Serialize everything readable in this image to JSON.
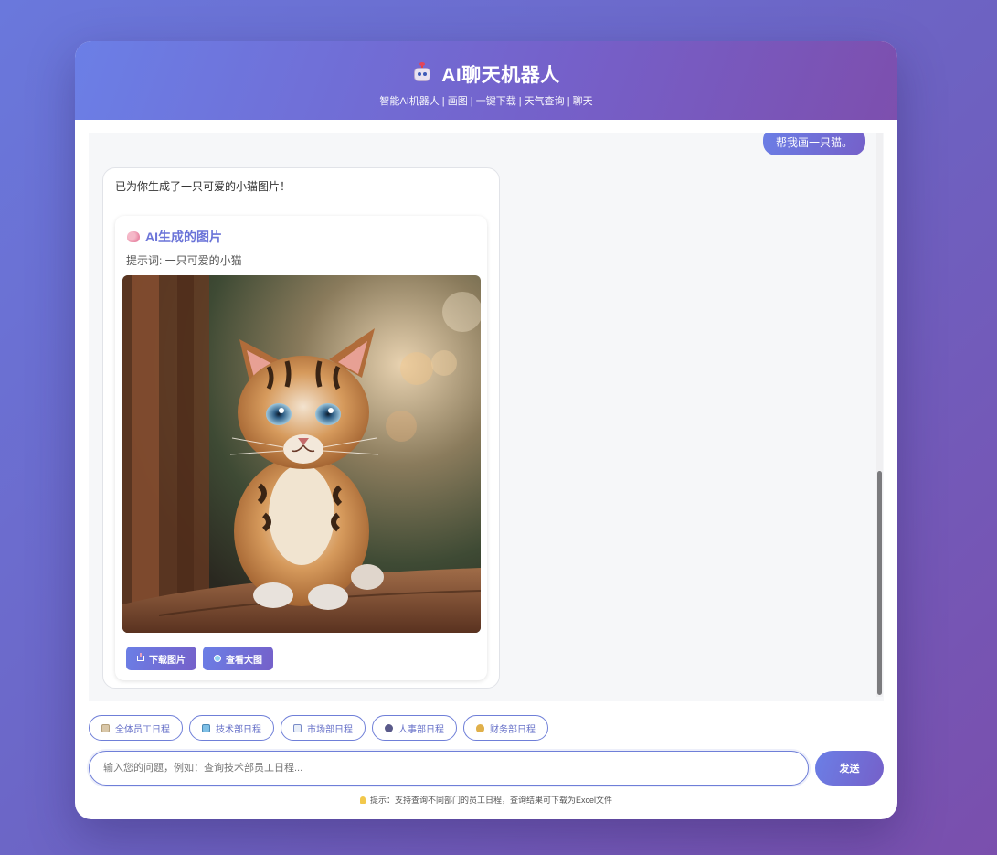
{
  "header": {
    "title": "AI聊天机器人",
    "subtitle": "智能AI机器人 | 画图 | 一键下载 | 天气查询 | 聊天"
  },
  "chat": {
    "user_message": "帮我画一只猫。",
    "bot_message": "已为你生成了一只可爱的小猫图片！",
    "image_card": {
      "title": "AI生成的图片",
      "prompt": "提示词: 一只可爱的小猫",
      "download_label": "下载图片",
      "view_label": "查看大图"
    }
  },
  "quick_actions": [
    {
      "label": "全体员工日程",
      "icon": "clipboard-icon"
    },
    {
      "label": "技术部日程",
      "icon": "computer-icon"
    },
    {
      "label": "市场部日程",
      "icon": "chart-icon"
    },
    {
      "label": "人事部日程",
      "icon": "people-icon"
    },
    {
      "label": "财务部日程",
      "icon": "money-bag-icon"
    }
  ],
  "input": {
    "placeholder": "输入您的问题，例如：查询技术部员工日程...",
    "value": ""
  },
  "send_label": "发送",
  "hint": "提示：支持查询不同部门的员工日程，查询结果可下载为Excel文件",
  "colors": {
    "accent": "#6b7fe6",
    "accent_dark": "#7560c9"
  }
}
